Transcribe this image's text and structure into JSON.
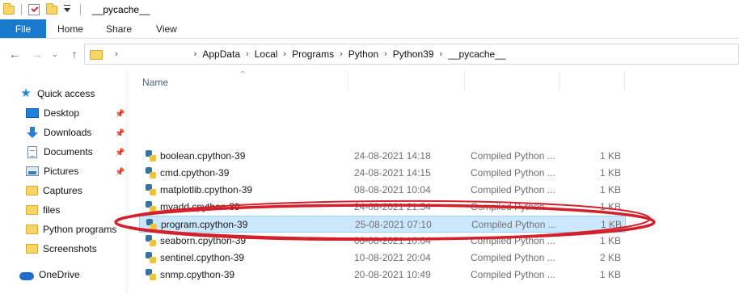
{
  "window": {
    "title": "__pycache__"
  },
  "ribbon": {
    "tabs": [
      {
        "label": "File"
      },
      {
        "label": "Home"
      },
      {
        "label": "Share"
      },
      {
        "label": "View"
      }
    ]
  },
  "address": {
    "crumbs": [
      "AppData",
      "Local",
      "Programs",
      "Python",
      "Python39",
      "__pycache__"
    ]
  },
  "sidebar": {
    "items": [
      {
        "label": "Quick access",
        "icon": "star-icon",
        "pinned": false
      },
      {
        "label": "Desktop",
        "icon": "desktop-icon",
        "pinned": true
      },
      {
        "label": "Downloads",
        "icon": "download-icon",
        "pinned": true
      },
      {
        "label": "Documents",
        "icon": "document-icon",
        "pinned": true
      },
      {
        "label": "Pictures",
        "icon": "pictures-icon",
        "pinned": true
      },
      {
        "label": "Captures",
        "icon": "folder-icon",
        "pinned": false
      },
      {
        "label": "files",
        "icon": "folder-icon",
        "pinned": false
      },
      {
        "label": "Python programs",
        "icon": "folder-icon",
        "pinned": false
      },
      {
        "label": "Screenshots",
        "icon": "folder-icon",
        "pinned": false
      },
      {
        "label": "OneDrive",
        "icon": "cloud-icon",
        "pinned": false
      }
    ]
  },
  "list": {
    "header_name": "Name",
    "files": [
      {
        "name": "boolean.cpython-39",
        "date": "24-08-2021 14:18",
        "type": "Compiled Python ...",
        "size": "1 KB"
      },
      {
        "name": "cmd.cpython-39",
        "date": "24-08-2021 14:15",
        "type": "Compiled Python ...",
        "size": "1 KB"
      },
      {
        "name": "matplotlib.cpython-39",
        "date": "08-08-2021 10:04",
        "type": "Compiled Python ...",
        "size": "1 KB"
      },
      {
        "name": "myadd.cpython-39",
        "date": "24-08-2021 21:54",
        "type": "Compiled Python ...",
        "size": "1 KB"
      },
      {
        "name": "program.cpython-39",
        "date": "25-08-2021 07:10",
        "type": "Compiled Python ...",
        "size": "1 KB",
        "selected": true
      },
      {
        "name": "seaborn.cpython-39",
        "date": "08-08-2021 10:04",
        "type": "Compiled Python ...",
        "size": "1 KB"
      },
      {
        "name": "sentinel.cpython-39",
        "date": "10-08-2021 20:04",
        "type": "Compiled Python ...",
        "size": "2 KB"
      },
      {
        "name": "snmp.cpython-39",
        "date": "20-08-2021 10:49",
        "type": "Compiled Python ...",
        "size": "1 KB"
      }
    ]
  },
  "colors": {
    "accent": "#1979ca",
    "selection": "#cce8ff",
    "annotation": "#d4202a"
  }
}
